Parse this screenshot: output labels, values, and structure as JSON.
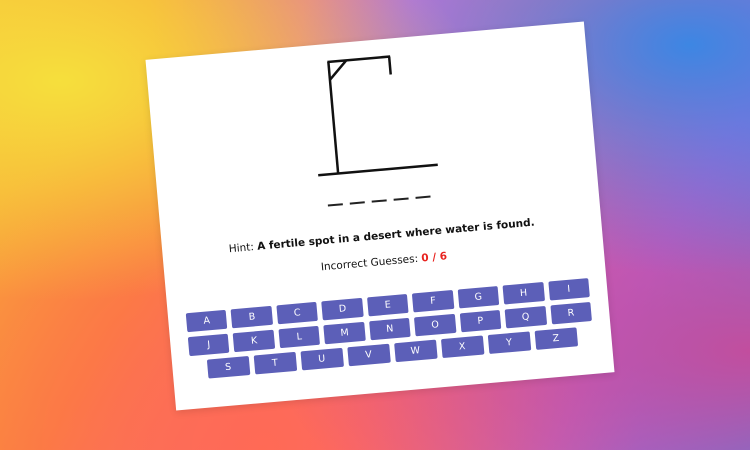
{
  "game": {
    "word_blanks": [
      "_",
      "_",
      "_",
      "_",
      "_"
    ],
    "hint_label": "Hint:",
    "hint_text": "A fertile spot in a desert where water is found.",
    "guesses_label": "Incorrect Guesses:",
    "guesses_value": "0 / 6",
    "guess_count": 0,
    "max_guesses": 6,
    "accent_color": "#e8231f",
    "key_color": "#5c5fb8"
  },
  "keyboard": {
    "rows": [
      [
        "A",
        "B",
        "C",
        "D",
        "E",
        "F",
        "G",
        "H",
        "I"
      ],
      [
        "J",
        "K",
        "L",
        "M",
        "N",
        "O",
        "P",
        "Q",
        "R"
      ],
      [
        "S",
        "T",
        "U",
        "V",
        "W",
        "X",
        "Y",
        "Z"
      ]
    ]
  }
}
